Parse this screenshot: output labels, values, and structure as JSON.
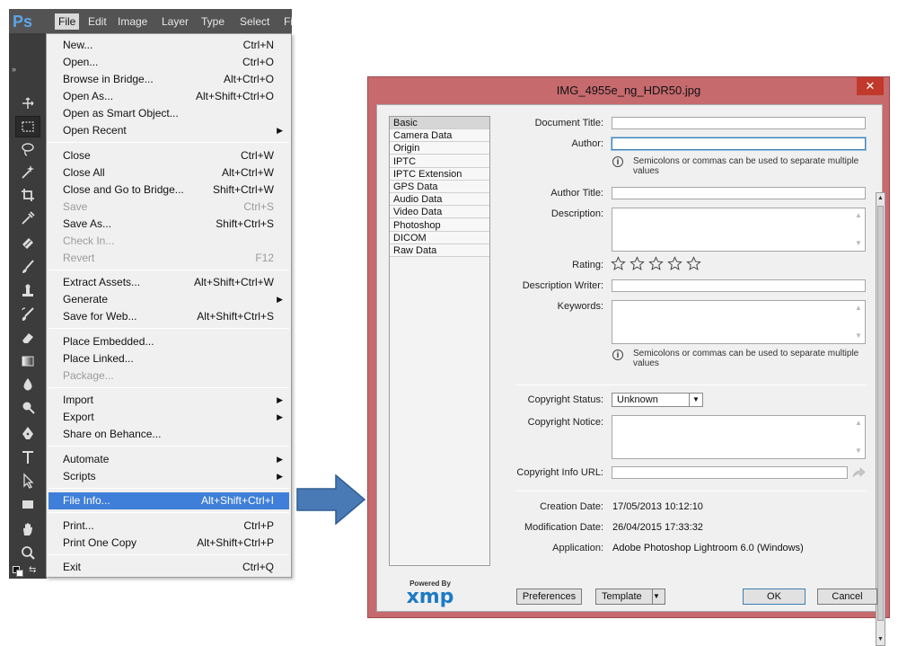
{
  "photoshop": {
    "logo": "Ps",
    "menubar": [
      "File",
      "Edit",
      "Image",
      "Layer",
      "Type",
      "Select",
      "Fi"
    ],
    "active_menu": "File",
    "file_menu": {
      "groups": [
        [
          {
            "label": "New...",
            "shortcut": "Ctrl+N"
          },
          {
            "label": "Open...",
            "shortcut": "Ctrl+O"
          },
          {
            "label": "Browse in Bridge...",
            "shortcut": "Alt+Ctrl+O"
          },
          {
            "label": "Open As...",
            "shortcut": "Alt+Shift+Ctrl+O"
          },
          {
            "label": "Open as Smart Object...",
            "shortcut": ""
          },
          {
            "label": "Open Recent",
            "shortcut": "",
            "submenu": true
          }
        ],
        [
          {
            "label": "Close",
            "shortcut": "Ctrl+W"
          },
          {
            "label": "Close All",
            "shortcut": "Alt+Ctrl+W"
          },
          {
            "label": "Close and Go to Bridge...",
            "shortcut": "Shift+Ctrl+W"
          },
          {
            "label": "Save",
            "shortcut": "Ctrl+S",
            "disabled": true
          },
          {
            "label": "Save As...",
            "shortcut": "Shift+Ctrl+S"
          },
          {
            "label": "Check In...",
            "shortcut": "",
            "disabled": true
          },
          {
            "label": "Revert",
            "shortcut": "F12",
            "disabled": true
          }
        ],
        [
          {
            "label": "Extract Assets...",
            "shortcut": "Alt+Shift+Ctrl+W"
          },
          {
            "label": "Generate",
            "shortcut": "",
            "submenu": true
          },
          {
            "label": "Save for Web...",
            "shortcut": "Alt+Shift+Ctrl+S"
          }
        ],
        [
          {
            "label": "Place Embedded...",
            "shortcut": ""
          },
          {
            "label": "Place Linked...",
            "shortcut": ""
          },
          {
            "label": "Package...",
            "shortcut": "",
            "disabled": true
          }
        ],
        [
          {
            "label": "Import",
            "shortcut": "",
            "submenu": true
          },
          {
            "label": "Export",
            "shortcut": "",
            "submenu": true
          },
          {
            "label": "Share on Behance...",
            "shortcut": ""
          }
        ],
        [
          {
            "label": "Automate",
            "shortcut": "",
            "submenu": true
          },
          {
            "label": "Scripts",
            "shortcut": "",
            "submenu": true
          }
        ],
        [
          {
            "label": "File Info...",
            "shortcut": "Alt+Shift+Ctrl+I",
            "highlighted": true
          }
        ],
        [
          {
            "label": "Print...",
            "shortcut": "Ctrl+P"
          },
          {
            "label": "Print One Copy",
            "shortcut": "Alt+Shift+Ctrl+P"
          }
        ],
        [
          {
            "label": "Exit",
            "shortcut": "Ctrl+Q"
          }
        ]
      ]
    },
    "tools": [
      "move-tool-icon",
      "marquee-tool-icon",
      "lasso-tool-icon",
      "magic-wand-tool-icon",
      "crop-tool-icon",
      "eyedropper-tool-icon",
      "healing-brush-tool-icon",
      "brush-tool-icon",
      "clone-stamp-tool-icon",
      "history-brush-tool-icon",
      "eraser-tool-icon",
      "gradient-tool-icon",
      "blur-tool-icon",
      "dodge-tool-icon",
      "pen-tool-icon",
      "type-tool-icon",
      "path-selection-tool-icon",
      "rectangle-tool-icon",
      "hand-tool-icon",
      "zoom-tool-icon"
    ]
  },
  "dialog": {
    "title": "IMG_4955e_ng_HDR50.jpg",
    "close_glyph": "✕",
    "categories": [
      "Basic",
      "Camera Data",
      "Origin",
      "IPTC",
      "IPTC Extension",
      "GPS Data",
      "Audio Data",
      "Video Data",
      "Photoshop",
      "DICOM",
      "Raw Data"
    ],
    "selected_category": "Basic",
    "labels": {
      "document_title": "Document Title:",
      "author": "Author:",
      "author_title": "Author Title:",
      "description": "Description:",
      "rating": "Rating:",
      "description_writer": "Description Writer:",
      "keywords": "Keywords:",
      "copyright_status": "Copyright Status:",
      "copyright_notice": "Copyright Notice:",
      "copyright_info_url": "Copyright Info URL:",
      "creation_date": "Creation Date:",
      "modification_date": "Modification Date:",
      "application": "Application:"
    },
    "hint_text": "Semicolons or commas can be used to separate multiple values",
    "rating_stars": 0,
    "rating_max": 5,
    "copyright_status_value": "Unknown",
    "values": {
      "creation_date": "17/05/2013 10:12:10",
      "modification_date": "26/04/2015 17:33:32",
      "application": "Adobe Photoshop Lightroom 6.0 (Windows)"
    },
    "xmp": {
      "powered_by": "Powered By",
      "logo": "xmp"
    },
    "buttons": {
      "preferences": "Preferences",
      "template": "Template",
      "ok": "OK",
      "cancel": "Cancel"
    }
  },
  "colors": {
    "ps_chrome": "#535353",
    "dialog_frame": "#c66a6e",
    "menu_highlight": "#3f7fd9",
    "arrow": "#4a7ab5"
  }
}
